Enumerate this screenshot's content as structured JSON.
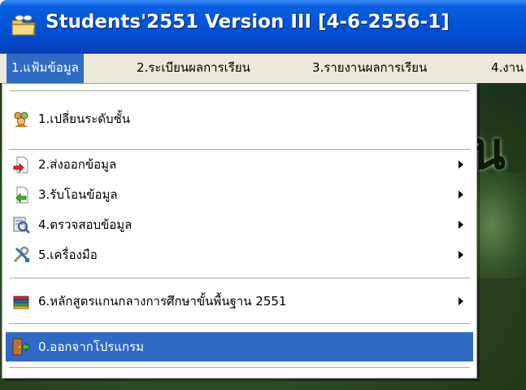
{
  "window": {
    "title": "Students'2551 Version III [4-6-2556-1]",
    "title_bar_color": "#0255d8"
  },
  "menubar": {
    "items": [
      {
        "label": "1.แฟ้มข้อมูล",
        "active": true
      },
      {
        "label": "2.ระเบียนผลการเรียน",
        "active": false
      },
      {
        "label": "3.รายงานผลการเรียน",
        "active": false
      },
      {
        "label": "4.งาน",
        "active": false
      }
    ]
  },
  "background": {
    "partial_glyph": "น"
  },
  "dropdown": {
    "highlight_color": "#316ac5",
    "items": [
      {
        "label": "1.เปลี่ยนระดับชั้น",
        "icon": "people-icon",
        "submenu": false
      },
      {
        "label": "2.ส่งออกข้อมูล",
        "icon": "export-icon",
        "submenu": true
      },
      {
        "label": "3.รับโอนข้อมูล",
        "icon": "import-icon",
        "submenu": true
      },
      {
        "label": "4.ตรวจสอบข้อมูล",
        "icon": "inspect-icon",
        "submenu": true
      },
      {
        "label": "5.เครื่องมือ",
        "icon": "tools-icon",
        "submenu": true
      },
      {
        "label": "6.หลักสูตรแกนกลางการศึกษาขั้นพื้นฐาน 2551",
        "icon": "books-icon",
        "submenu": true
      },
      {
        "label": "0.ออกจากโปรแกรม",
        "icon": "exit-door-icon",
        "submenu": false,
        "active": true
      }
    ]
  }
}
